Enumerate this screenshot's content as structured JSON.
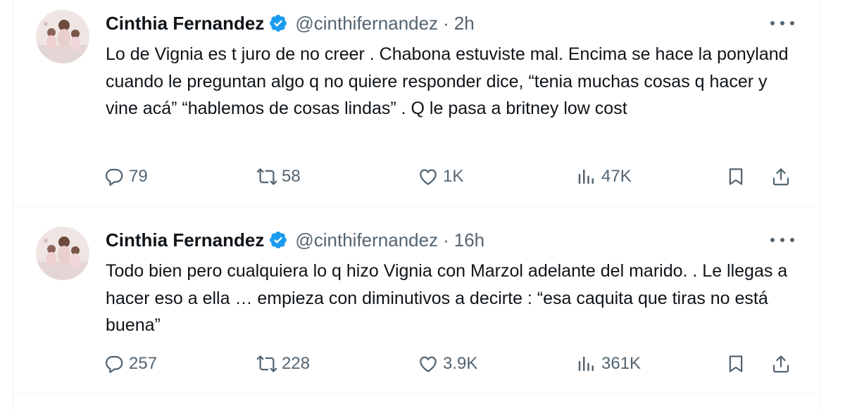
{
  "colors": {
    "text": "#0f1419",
    "secondary": "#536471",
    "verified_blue": "#1d9bf0",
    "divider": "#eff3f4"
  },
  "icons": [
    "avatar",
    "verified-badge-icon",
    "more-icon",
    "reply-icon",
    "retweet-icon",
    "like-icon",
    "views-icon",
    "bookmark-icon",
    "share-icon"
  ],
  "tweets": [
    {
      "name": "Cinthia Fernandez",
      "handle": "@cinthifernandez",
      "separator": "·",
      "time": "2h",
      "text": "Lo de Vignia es t juro de no creer . Chabona estuviste mal. Encima se hace la ponyland cuando le preguntan algo q no quiere responder dice, “tenia muchas cosas q hacer y vine acá” “hablemos de cosas lindas” . Q le pasa a britney low cost",
      "replies": "79",
      "retweets": "58",
      "likes": "1K",
      "views": "47K"
    },
    {
      "name": "Cinthia Fernandez",
      "handle": "@cinthifernandez",
      "separator": "·",
      "time": "16h",
      "text": "Todo bien pero cualquiera lo q hizo Vignia con Marzol adelante del marido. . Le llegas a hacer eso a ella … empieza con diminutivos a decirte : “esa caquita  que tiras no está buena”",
      "replies": "257",
      "retweets": "228",
      "likes": "3.9K",
      "views": "361K"
    }
  ]
}
